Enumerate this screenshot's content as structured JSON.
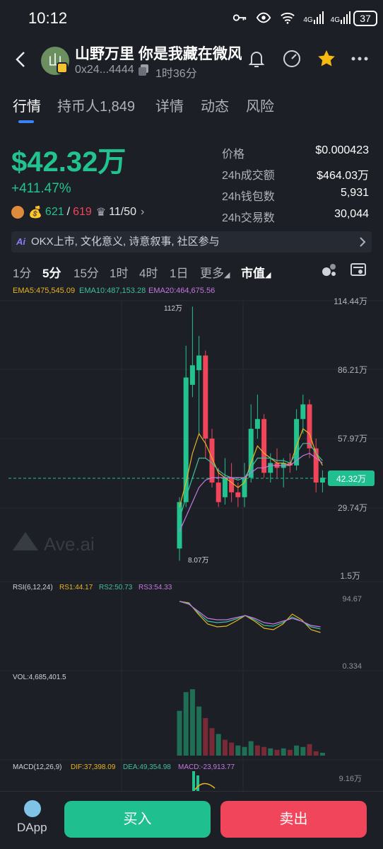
{
  "status": {
    "time": "10:12",
    "battery": "37",
    "net1": "4G",
    "net2": "4G"
  },
  "header": {
    "title": "山野万里 你是我藏在微风",
    "avatar_char": "山",
    "address": "0x24...4444",
    "age": "1时36分"
  },
  "tabs": [
    {
      "label": "行情"
    },
    {
      "label": "持币人1,849"
    },
    {
      "label": "详情"
    },
    {
      "label": "动态"
    },
    {
      "label": "风险"
    }
  ],
  "summary": {
    "market_cap": "$42.32万",
    "change": "+411.47%",
    "holders_a": "621",
    "sep": "/",
    "holders_b": "619",
    "crown_count": "11/50"
  },
  "stats": [
    {
      "label": "价格",
      "value": "$0.000423"
    },
    {
      "label": "24h成交额",
      "value": "$464.03万"
    },
    {
      "label": "24h钱包数",
      "value": "5,931"
    },
    {
      "label": "24h交易数",
      "value": "30,044"
    }
  ],
  "ai_bar": {
    "logo": "Ai",
    "text": "OKX上市, 文化意义, 诗意叙事, 社区参与"
  },
  "timeframes": [
    "1分",
    "5分",
    "15分",
    "1时",
    "4时",
    "1日",
    "更多",
    "市值"
  ],
  "chart_data": {
    "type": "candlestick",
    "ema_labels": {
      "ema5": "EMA5:475,545.09",
      "ema10": "EMA10:487,153.28",
      "ema20": "EMA20:464,675.56"
    },
    "y_ticks": [
      "114.44万",
      "86.21万",
      "57.97万",
      "29.74万",
      "1.5万"
    ],
    "current_value": "42.32万",
    "high_label": "112万",
    "low_label": "8.07万",
    "watermark": "Ave.ai",
    "colors": {
      "up": "#22c38e",
      "down": "#f0455a",
      "ema5": "#e6b422",
      "ema10": "#3fbfa0",
      "ema20": "#c478e0"
    },
    "candles": [
      {
        "o": 13,
        "c": 32,
        "h": 34,
        "l": 8
      },
      {
        "o": 32,
        "c": 83,
        "h": 96,
        "l": 30
      },
      {
        "o": 80,
        "c": 88,
        "h": 112,
        "l": 75
      },
      {
        "o": 86,
        "c": 92,
        "h": 100,
        "l": 60
      },
      {
        "o": 92,
        "c": 58,
        "h": 94,
        "l": 50
      },
      {
        "o": 58,
        "c": 40,
        "h": 62,
        "l": 38
      },
      {
        "o": 40,
        "c": 32,
        "h": 46,
        "l": 30
      },
      {
        "o": 34,
        "c": 42,
        "h": 50,
        "l": 31
      },
      {
        "o": 42,
        "c": 36,
        "h": 48,
        "l": 32
      },
      {
        "o": 36,
        "c": 34,
        "h": 40,
        "l": 30
      },
      {
        "o": 34,
        "c": 42,
        "h": 48,
        "l": 30
      },
      {
        "o": 42,
        "c": 62,
        "h": 72,
        "l": 40
      },
      {
        "o": 62,
        "c": 66,
        "h": 76,
        "l": 58
      },
      {
        "o": 66,
        "c": 44,
        "h": 68,
        "l": 42
      },
      {
        "o": 44,
        "c": 48,
        "h": 52,
        "l": 40
      },
      {
        "o": 48,
        "c": 46,
        "h": 54,
        "l": 42
      },
      {
        "o": 46,
        "c": 48,
        "h": 50,
        "l": 38
      },
      {
        "o": 48,
        "c": 47,
        "h": 52,
        "l": 44
      },
      {
        "o": 47,
        "c": 66,
        "h": 70,
        "l": 45
      },
      {
        "o": 66,
        "c": 72,
        "h": 76,
        "l": 60
      },
      {
        "o": 72,
        "c": 54,
        "h": 74,
        "l": 50
      },
      {
        "o": 54,
        "c": 40,
        "h": 58,
        "l": 36
      },
      {
        "o": 40,
        "c": 42,
        "h": 45,
        "l": 36
      }
    ],
    "ema5": [
      30,
      40,
      52,
      60,
      56,
      50,
      44,
      42,
      40,
      38,
      40,
      48,
      55,
      52,
      50,
      48,
      48,
      47,
      55,
      62,
      60,
      52,
      47
    ],
    "ema10": [
      25,
      34,
      42,
      50,
      50,
      48,
      45,
      43,
      42,
      41,
      42,
      46,
      50,
      50,
      50,
      49,
      49,
      48,
      52,
      56,
      56,
      52,
      49
    ],
    "ema20": [
      20,
      26,
      32,
      38,
      41,
      42,
      42,
      42,
      42,
      42,
      42,
      44,
      46,
      46,
      47,
      47,
      47,
      47,
      49,
      51,
      52,
      50,
      48
    ],
    "rsi": {
      "label": "RSI(6,12,24)",
      "rs1": "RS1:44.17",
      "rs2": "RS2:50.73",
      "rs3": "RS3:54.33",
      "top": "94.67",
      "bottom": "0.334",
      "rs1_values": [
        90,
        88,
        72,
        58,
        54,
        55,
        62,
        70,
        62,
        52,
        50,
        58,
        72,
        64,
        50,
        46
      ],
      "rs2_values": [
        90,
        87,
        74,
        62,
        60,
        61,
        65,
        70,
        64,
        56,
        55,
        60,
        68,
        62,
        54,
        51
      ],
      "rs3_values": [
        90,
        86,
        76,
        66,
        64,
        64,
        67,
        70,
        66,
        60,
        58,
        62,
        66,
        62,
        56,
        54
      ]
    },
    "volume": {
      "label": "VOL:4,685,401.5",
      "bars": [
        {
          "v": 62,
          "up": true
        },
        {
          "v": 88,
          "up": true
        },
        {
          "v": 92,
          "up": true
        },
        {
          "v": 68,
          "up": true
        },
        {
          "v": 52,
          "up": false
        },
        {
          "v": 38,
          "up": false
        },
        {
          "v": 30,
          "up": true
        },
        {
          "v": 22,
          "up": false
        },
        {
          "v": 18,
          "up": false
        },
        {
          "v": 14,
          "up": true
        },
        {
          "v": 12,
          "up": true
        },
        {
          "v": 20,
          "up": true
        },
        {
          "v": 14,
          "up": false
        },
        {
          "v": 12,
          "up": false
        },
        {
          "v": 10,
          "up": true
        },
        {
          "v": 8,
          "up": false
        },
        {
          "v": 10,
          "up": true
        },
        {
          "v": 8,
          "up": false
        },
        {
          "v": 14,
          "up": true
        },
        {
          "v": 12,
          "up": true
        },
        {
          "v": 16,
          "up": false
        },
        {
          "v": 6,
          "up": false
        },
        {
          "v": 4,
          "up": true
        }
      ]
    },
    "macd": {
      "label": "MACD(12,26,9)",
      "dif": "DIF:37,398.09",
      "dea": "DEA:49,354.98",
      "macd": "MACD:-23,913.77",
      "top": "9.16万"
    }
  },
  "bottom": {
    "dapp": "DApp",
    "buy": "买入",
    "sell": "卖出"
  }
}
